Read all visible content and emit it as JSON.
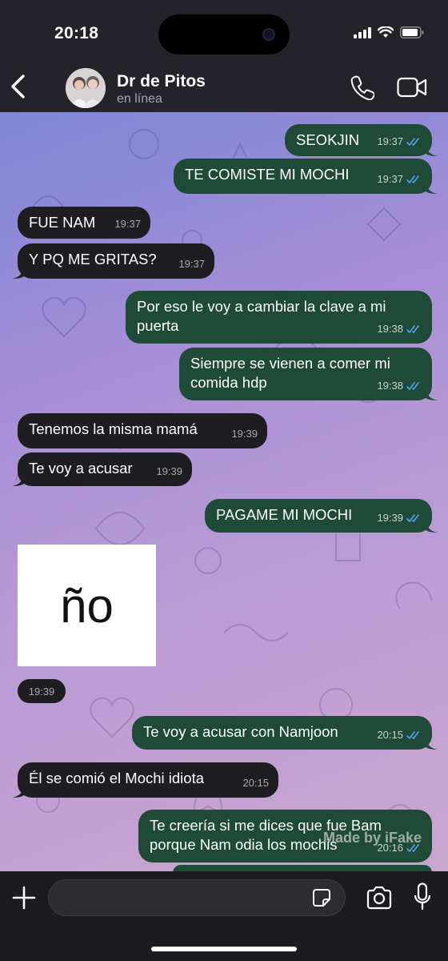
{
  "status_bar": {
    "time": "20:18",
    "battery_level": 0.9
  },
  "header": {
    "contact_name": "Dr de Pitos",
    "contact_status": "en línea",
    "icons": [
      "back-icon",
      "avatar",
      "phone-icon",
      "video-icon"
    ]
  },
  "colors": {
    "outgoing_bubble": "#1f4a38",
    "incoming_bubble": "#1e1e22",
    "read_ticks": "#4fa3f0",
    "bar_background": "#232329"
  },
  "messages": [
    {
      "dir": "out",
      "text": "SEOKJIN",
      "time": "19:37",
      "read": true
    },
    {
      "dir": "out",
      "text": "TE COMISTE MI MOCHI",
      "time": "19:37",
      "read": true
    },
    {
      "dir": "in",
      "text": "FUE NAM",
      "time": "19:37"
    },
    {
      "dir": "in",
      "text": "Y PQ ME GRITAS?",
      "time": "19:37"
    },
    {
      "dir": "out",
      "text": "Por eso le voy a cambiar la clave a mi\npuerta",
      "time": "19:38",
      "read": true
    },
    {
      "dir": "out",
      "text": "Siempre se vienen a comer mi\ncomida hdp",
      "time": "19:38",
      "read": true
    },
    {
      "dir": "in",
      "text": "Tenemos la misma mamá",
      "time": "19:39"
    },
    {
      "dir": "in",
      "text": "Te voy a acusar",
      "time": "19:39"
    },
    {
      "dir": "out",
      "text": "PAGAME MI MOCHI",
      "time": "19:39",
      "read": true
    },
    {
      "dir": "out",
      "text": "Te voy a acusar con Namjoon",
      "time": "20:15",
      "read": true
    },
    {
      "dir": "in",
      "text": "Él se comió el Mochi idiota",
      "time": "20:15"
    },
    {
      "dir": "out",
      "text": "Te creería si me dices que fue Bam\nporque Nam odia los mochis",
      "time": "20:16",
      "read": true
    }
  ],
  "sticker": {
    "text": "ño",
    "time": "19:39"
  },
  "watermark": "Made by iFake",
  "composer": {
    "value": "",
    "placeholder": ""
  }
}
